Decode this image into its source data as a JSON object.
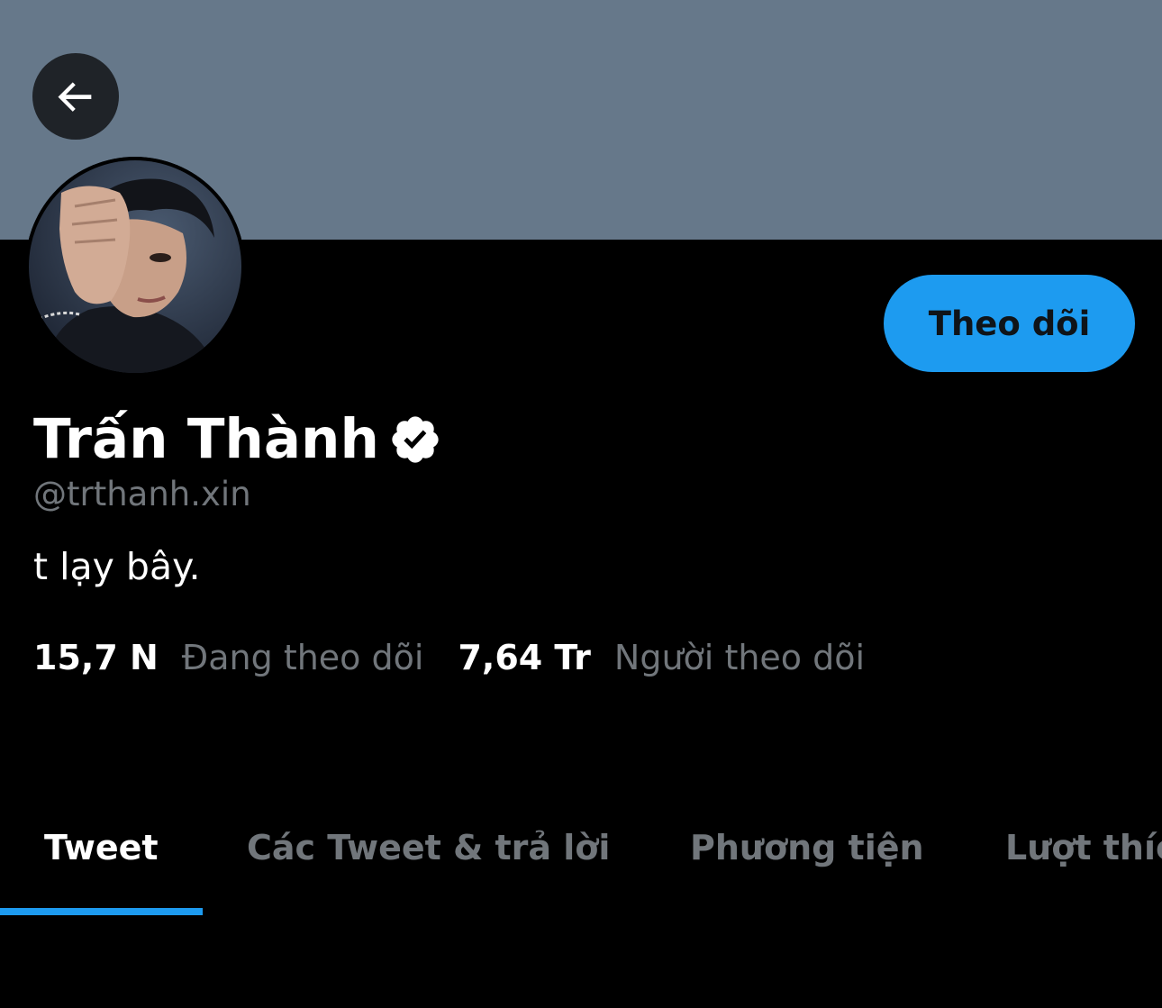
{
  "profile": {
    "name": "Trấn Thành",
    "handle": "@trthanh.xin",
    "bio": "t lạy bây.",
    "verified": true,
    "follow_button": "Theo dõi",
    "stats": {
      "following_count": "15,7 N",
      "following_label": "Đang theo dõi",
      "followers_count": "7,64 Tr",
      "followers_label": "Người theo dõi"
    }
  },
  "tabs": [
    {
      "label": "Tweet",
      "active": true
    },
    {
      "label": "Các Tweet & trả lời",
      "active": false
    },
    {
      "label": "Phương tiện",
      "active": false
    },
    {
      "label": "Lượt thích",
      "active": false
    }
  ],
  "icons": {
    "back": "arrow-left-icon",
    "verified": "verified-badge-icon"
  },
  "colors": {
    "banner": "#66788a",
    "accent": "#1d9bf0",
    "background": "#000000",
    "secondary_text": "#71767b"
  }
}
